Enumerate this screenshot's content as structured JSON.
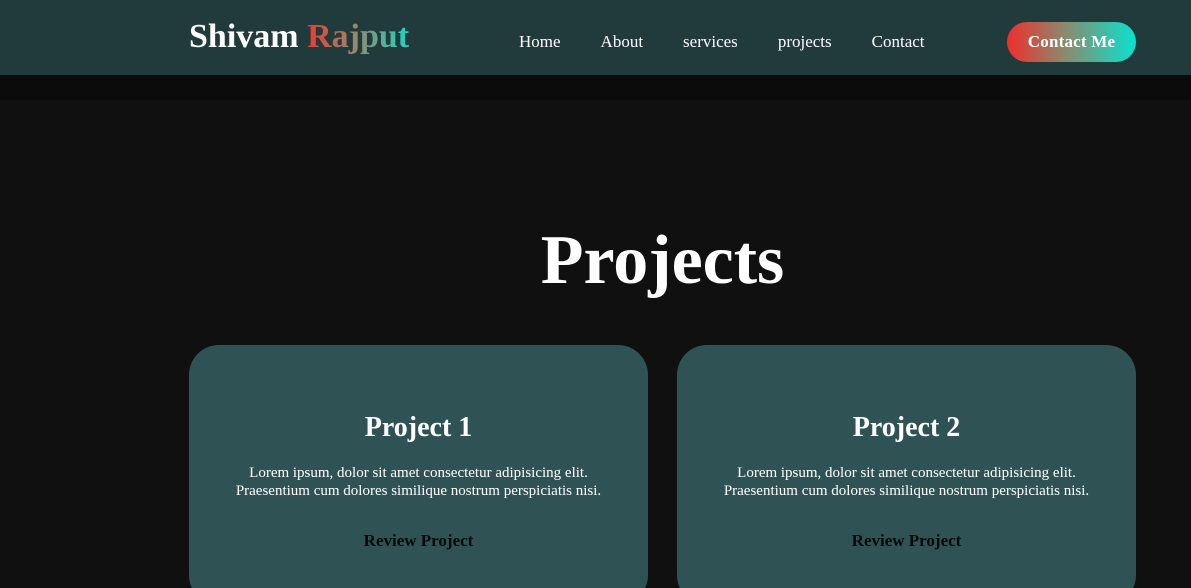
{
  "header": {
    "logo_first": "Shivam",
    "logo_second": "Rajput",
    "nav": [
      {
        "label": "Home"
      },
      {
        "label": "About"
      },
      {
        "label": "services"
      },
      {
        "label": "projects"
      },
      {
        "label": "Contact"
      }
    ],
    "cta_label": "Contact Me"
  },
  "projects": {
    "title": "Projects",
    "cards": [
      {
        "title": "Project 1",
        "desc_line1": "Lorem ipsum, dolor sit amet consectetur adipisicing elit.",
        "desc_line2": "Praesentium cum dolores similique nostrum perspiciatis nisi.",
        "link": "Review Project"
      },
      {
        "title": "Project 2",
        "desc_line1": "Lorem ipsum, dolor sit amet consectetur adipisicing elit.",
        "desc_line2": "Praesentium cum dolores similique nostrum perspiciatis nisi.",
        "link": "Review Project"
      }
    ]
  },
  "colors": {
    "navbar_bg": "#213a3c",
    "page_bg": "#101010",
    "card_bg": "#2f5254",
    "gradient_start": "#ef2e2c",
    "gradient_end": "#08e2cf"
  }
}
